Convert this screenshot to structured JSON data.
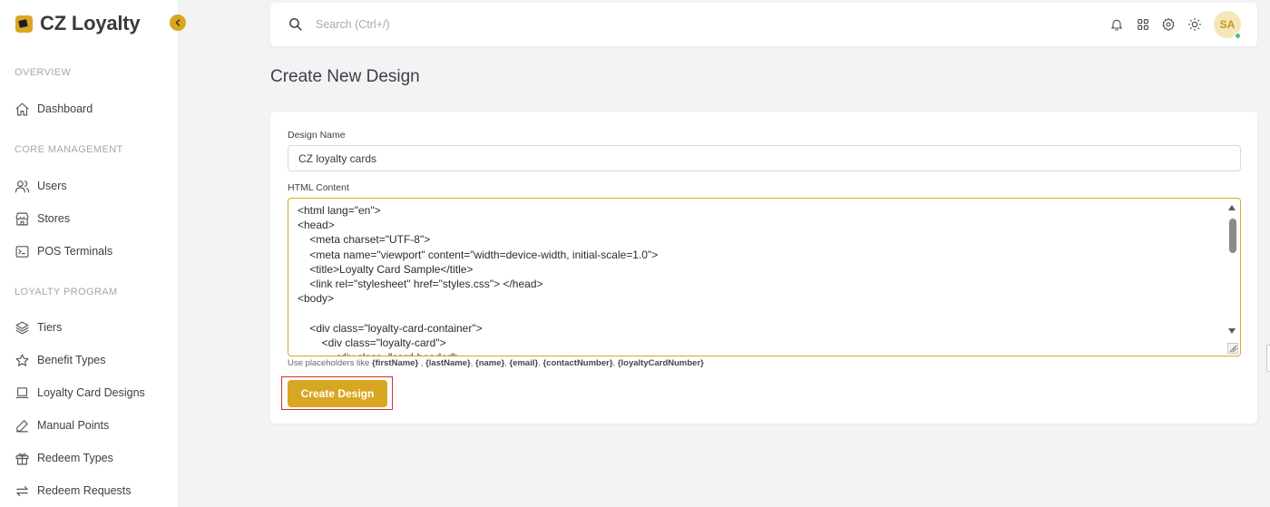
{
  "brand": {
    "name": "CZ Loyalty"
  },
  "sidebar": {
    "sections": [
      {
        "title": "OVERVIEW"
      },
      {
        "title": "CORE MANAGEMENT"
      },
      {
        "title": "LOYALTY PROGRAM"
      }
    ],
    "items": [
      {
        "label": "Dashboard",
        "icon": "home-icon"
      },
      {
        "label": "Users",
        "icon": "users-icon"
      },
      {
        "label": "Stores",
        "icon": "store-icon"
      },
      {
        "label": "POS Terminals",
        "icon": "terminal-icon"
      },
      {
        "label": "Tiers",
        "icon": "layers-icon"
      },
      {
        "label": "Benefit Types",
        "icon": "star-icon"
      },
      {
        "label": "Loyalty Card Designs",
        "icon": "laptop-icon"
      },
      {
        "label": "Manual Points",
        "icon": "pencil-icon"
      },
      {
        "label": "Redeem Types",
        "icon": "gift-icon"
      },
      {
        "label": "Redeem Requests",
        "icon": "swap-icon"
      }
    ]
  },
  "topbar": {
    "search_placeholder": "Search (Ctrl+/)",
    "avatar_initials": "SA"
  },
  "page": {
    "title": "Create New Design"
  },
  "form": {
    "design_name_label": "Design Name",
    "design_name_value": "CZ loyalty cards",
    "html_label": "HTML Content",
    "html_lines": [
      "<html lang=\"en\">",
      "<head>",
      "    <meta charset=\"UTF-8\">",
      "    <meta name=\"viewport\" content=\"width=device-width, initial-scale=1.0\">",
      "    <title>Loyalty Card Sample</title>",
      "    <link rel=\"stylesheet\" href=\"styles.css\"> </head>",
      "<body>",
      "",
      "    <div class=\"loyalty-card-container\">",
      "        <div class=\"loyalty-card\">",
      "            <div class=\"card-header\">"
    ],
    "hint_prefix": "Use placeholders like ",
    "placeholders": [
      "{firstName}",
      "{lastName}",
      "{name}",
      "{email}",
      "{contactNumber}",
      "{loyaltyCardNumber}"
    ],
    "submit_label": "Create Design"
  },
  "colors": {
    "accent": "#d8a722",
    "highlight_border": "#d22d2d",
    "online_dot": "#3ec56b"
  }
}
